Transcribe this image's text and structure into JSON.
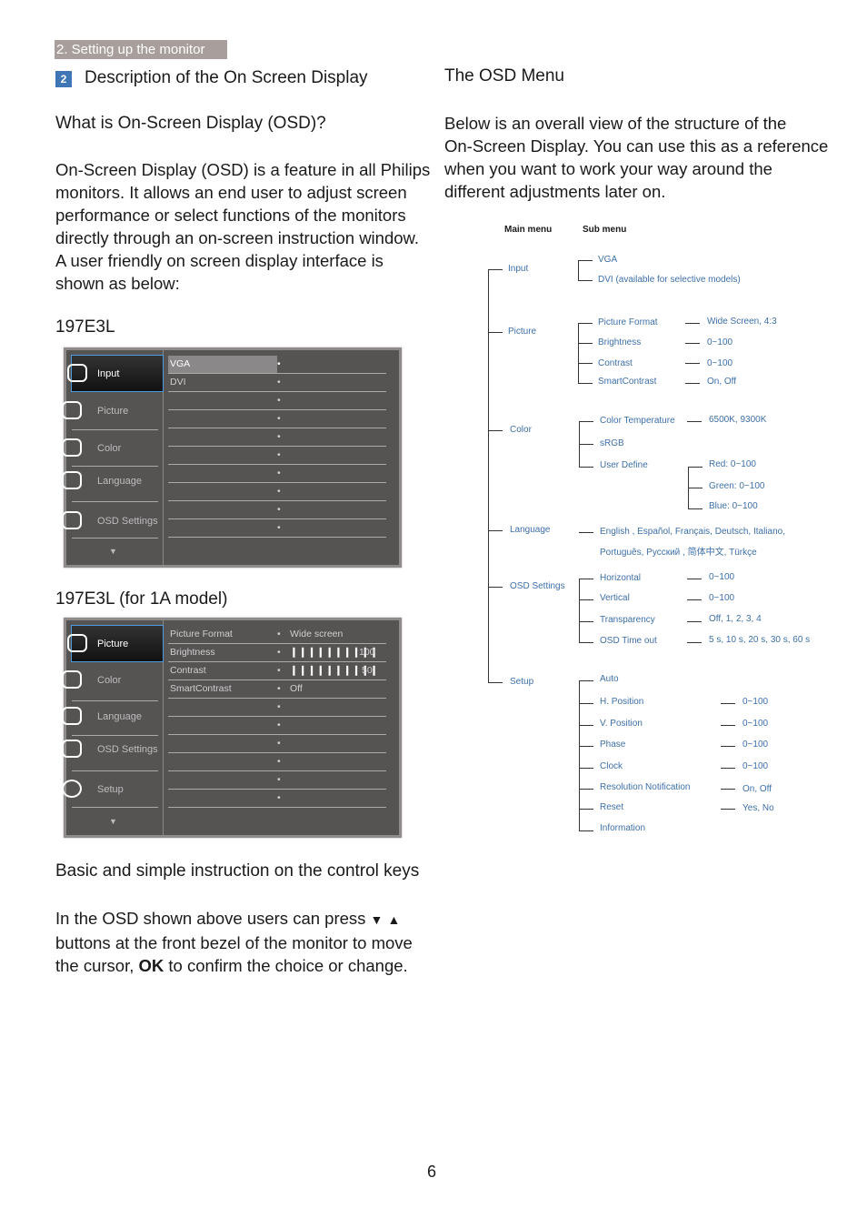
{
  "header": {
    "section_tag": "2. Setting up the monitor",
    "section_number": "2",
    "section_title": "Description of the On Screen Display"
  },
  "left": {
    "what_is_heading": "What is On-Screen Display (OSD)?",
    "intro_lines": [
      "On-Screen Display (OSD) is a feature in all Philips",
      "monitors. It allows an end user to adjust screen",
      "performance or select functions of the monitors",
      "directly through an on-screen instruction window.",
      "A user friendly on screen display interface is",
      "shown as below:"
    ],
    "model1_label": "197E3L",
    "model2_label": "197E3L (for 1A model)",
    "controls_heading": "Basic and simple instruction on the control keys",
    "controls_lines": [
      "In the OSD shown above users can press",
      "buttons at the front bezel of the monitor to move",
      "the cursor,",
      "to confirm the choice or change."
    ],
    "down_glyph": "▼",
    "up_glyph": "▲",
    "ok_label": "OK"
  },
  "osd1": {
    "menu": [
      "Input",
      "Picture",
      "Color",
      "Language",
      "OSD Settings"
    ],
    "rows": [
      {
        "label": "VGA"
      },
      {
        "label": "DVI"
      }
    ],
    "empty_rows": 8,
    "scroll_glyph": "▼"
  },
  "osd2": {
    "menu": [
      "Picture",
      "Color",
      "Language",
      "OSD Settings",
      "Setup"
    ],
    "rows": [
      {
        "label": "Picture Format",
        "value": "Wide screen"
      },
      {
        "label": "Brightness",
        "value": "100",
        "bars": "❙❙❙❙❙❙❙❙❙❙"
      },
      {
        "label": "Contrast",
        "value": "50",
        "bars": "❙❙❙❙❙❙❙❙❙❙"
      },
      {
        "label": "SmartContrast",
        "value": "Off"
      }
    ],
    "scroll_glyph": "▼"
  },
  "right": {
    "heading": "The OSD Menu",
    "intro_lines": [
      "Below is an overall view of the structure of the",
      "On-Screen Display. You can use this as a reference",
      "when you want to work your way around the",
      "different adjustments later on."
    ]
  },
  "tree": {
    "main_header": "Main menu",
    "sub_header": "Sub menu",
    "input": {
      "label": "Input",
      "items": [
        "VGA",
        "DVI (available for selective models)"
      ]
    },
    "picture": {
      "label": "Picture",
      "items": [
        "Picture Format",
        "Brightness",
        "Contrast",
        "SmartContrast"
      ],
      "values": [
        "Wide Screen, 4:3",
        "0~100",
        "0~100",
        "On, Off"
      ]
    },
    "color": {
      "label": "Color",
      "items": [
        "Color Temperature",
        "sRGB",
        "User Define"
      ],
      "temp_value": "6500K, 9300K",
      "user_values": [
        "Red: 0~100",
        "Green: 0~100",
        "Blue: 0~100"
      ]
    },
    "language": {
      "label": "Language",
      "line1": "English , Español, Français, Deutsch, Italiano,",
      "line2": "Português, Русский , 简体中文, Türkçe"
    },
    "osd": {
      "label": "OSD Settings",
      "items": [
        "Horizontal",
        "Vertical",
        "Transparency",
        "OSD Time out"
      ],
      "values": [
        "0~100",
        "0~100",
        "Off, 1, 2, 3, 4",
        "5 s, 10 s, 20 s, 30 s, 60 s"
      ]
    },
    "setup": {
      "label": "Setup",
      "items": [
        "Auto",
        "H. Position",
        "V. Position",
        "Phase",
        "Clock",
        "Resolution Notification",
        "Reset",
        "Information"
      ],
      "values": [
        "",
        "0~100",
        "0~100",
        "0~100",
        "0~100",
        "On, Off",
        "Yes, No",
        ""
      ]
    }
  },
  "footer": {
    "page_number": "6"
  }
}
